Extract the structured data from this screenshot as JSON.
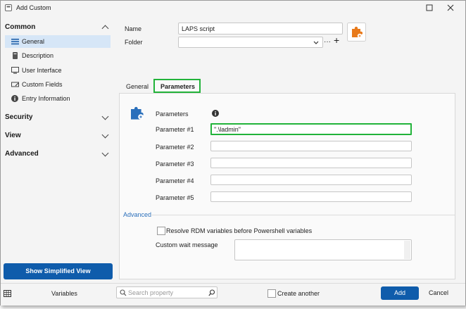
{
  "window": {
    "title": "Add Custom"
  },
  "sidebar": {
    "sections": [
      {
        "label": "Common",
        "expanded": true
      },
      {
        "label": "Security",
        "expanded": false
      },
      {
        "label": "View",
        "expanded": false
      },
      {
        "label": "Advanced",
        "expanded": false
      }
    ],
    "items": [
      {
        "label": "General",
        "icon": "menu-icon",
        "selected": true
      },
      {
        "label": "Description",
        "icon": "book-icon"
      },
      {
        "label": "User Interface",
        "icon": "monitor-icon"
      },
      {
        "label": "Custom Fields",
        "icon": "fields-icon"
      },
      {
        "label": "Entry Information",
        "icon": "info-icon"
      }
    ],
    "simplified_button": "Show Simplified View"
  },
  "form": {
    "name_label": "Name",
    "name_value": "LAPS script",
    "folder_label": "Folder",
    "folder_value": "",
    "folder_more": "···",
    "folder_add": "+"
  },
  "tabs": [
    {
      "label": "General",
      "active": false
    },
    {
      "label": "Parameters",
      "active": true
    }
  ],
  "parameters": {
    "header": "Parameters",
    "items": [
      {
        "label": "Parameter #1",
        "value": "\".\\ladmin\"",
        "highlighted": true
      },
      {
        "label": "Parameter #2",
        "value": ""
      },
      {
        "label": "Parameter #3",
        "value": ""
      },
      {
        "label": "Parameter #4",
        "value": ""
      },
      {
        "label": "Parameter #5",
        "value": ""
      }
    ],
    "advanced_label": "Advanced",
    "resolve_label": "Resolve RDM variables before Powershell variables",
    "custom_wait_label": "Custom wait message",
    "custom_wait_value": ""
  },
  "bottom": {
    "variables_label": "Variables",
    "search_placeholder": "Search property",
    "create_another_label": "Create another",
    "add_label": "Add",
    "cancel_label": "Cancel"
  },
  "colors": {
    "accent": "#0f5cab",
    "highlight": "#22b33a",
    "selected": "#d6e6f7",
    "puzzle_orange": "#e87a1b",
    "puzzle_blue": "#2a6fbb"
  }
}
